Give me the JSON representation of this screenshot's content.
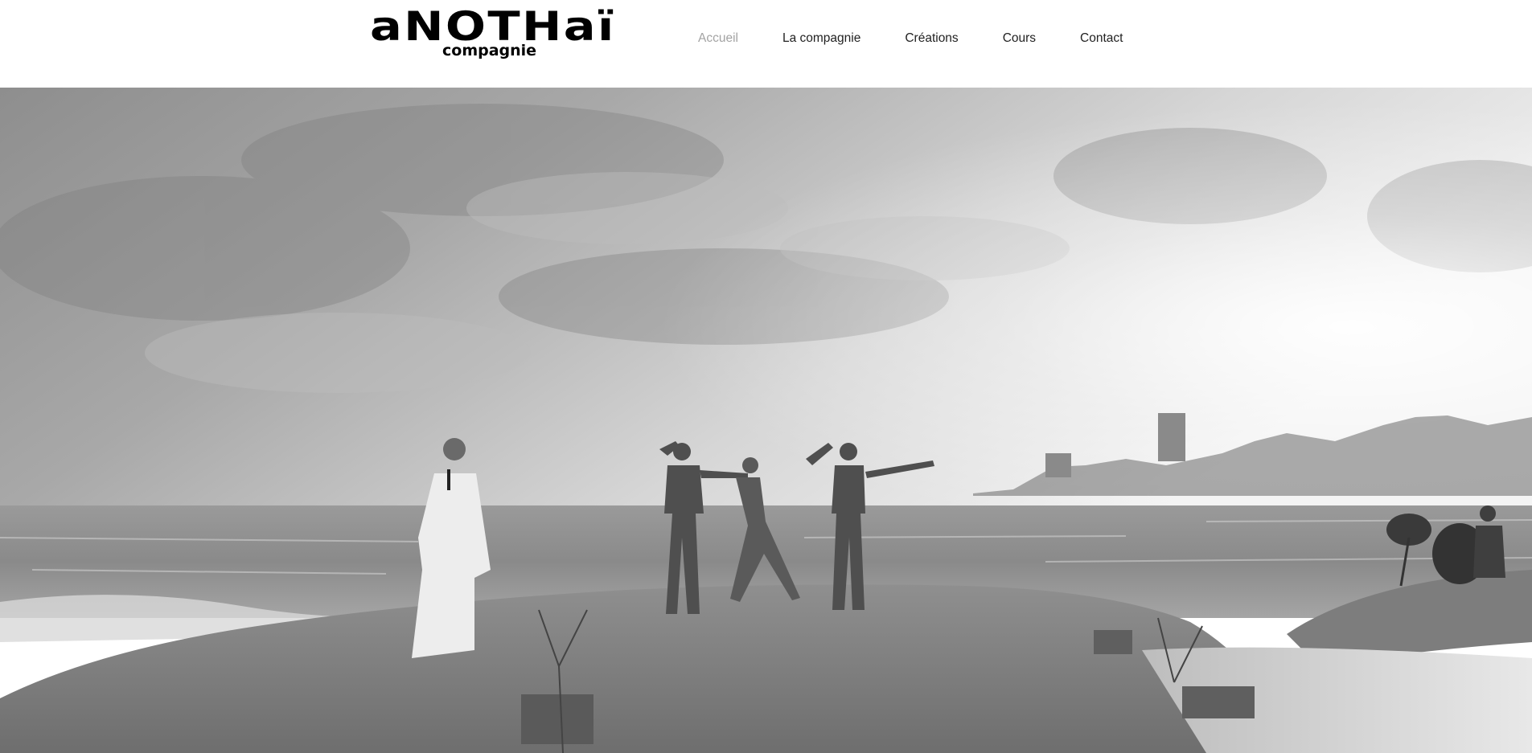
{
  "site": {
    "logo_main": "aNOTHaï",
    "logo_sub": "compagnie"
  },
  "nav": {
    "items": [
      {
        "label": "Accueil",
        "active": true
      },
      {
        "label": "La compagnie",
        "active": false
      },
      {
        "label": "Créations",
        "active": false
      },
      {
        "label": "Cours",
        "active": false
      },
      {
        "label": "Contact",
        "active": false
      }
    ]
  },
  "colors": {
    "background": "#ffffff",
    "nav_text": "#222222",
    "nav_active": "#a3a3a3"
  }
}
